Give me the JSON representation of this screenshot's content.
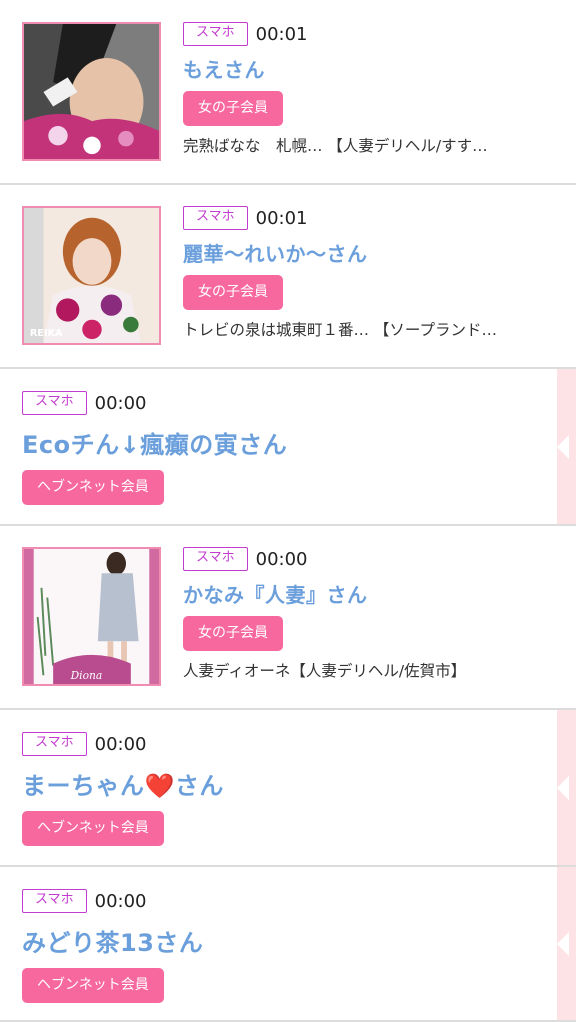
{
  "rows": [
    {
      "device": "スマホ",
      "time": "00:01",
      "name": "もえさん",
      "member": "女の子会員",
      "shop": "完熟ばなな　札幌…  【人妻デリヘル/すす…"
    },
    {
      "device": "スマホ",
      "time": "00:01",
      "name": "麗華〜れいか〜さん",
      "member": "女の子会員",
      "shop": "トレビの泉は城東町１番…  【ソープランド…",
      "photo_caption": "REIKA"
    },
    {
      "device": "スマホ",
      "time": "00:00",
      "name": "Ecoチん↓瘋癲の寅さん",
      "member": "ヘブンネット会員"
    },
    {
      "device": "スマホ",
      "time": "00:00",
      "name": "かなみ『人妻』さん",
      "member": "女の子会員",
      "shop": "人妻ディオーネ【人妻デリヘル/佐賀市】",
      "photo_caption": "Diona"
    },
    {
      "device": "スマホ",
      "time": "00:00",
      "name": "まーちゃん❤️さん",
      "member": "ヘブンネット会員"
    },
    {
      "device": "スマホ",
      "time": "00:00",
      "name": "みどり茶13さん",
      "member": "ヘブンネット会員"
    }
  ],
  "colors": {
    "device_badge": "#c33bd0",
    "name": "#6b9fdc",
    "member_badge": "#f7699e",
    "thumb_border": "#f08cb1",
    "stripe": "#fde3e6"
  }
}
